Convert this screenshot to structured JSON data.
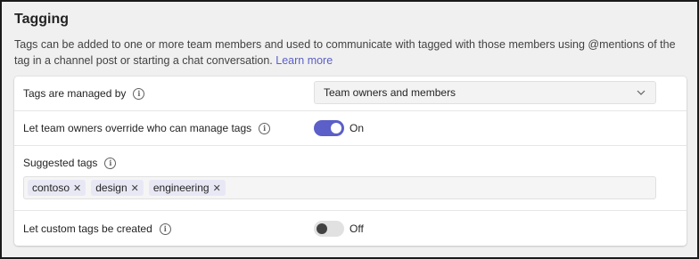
{
  "section": {
    "title": "Tagging",
    "description": "Tags can be added to one or more team members and used to communicate with tagged with those members using @mentions of the tag in a channel post or starting a chat conversation.",
    "learn_more": "Learn more"
  },
  "settings": {
    "managed_by": {
      "label": "Tags are managed by",
      "selected": "Team owners and members"
    },
    "override": {
      "label": "Let team owners override who can manage tags",
      "state": "On",
      "enabled": true
    },
    "suggested": {
      "label": "Suggested tags",
      "tags": [
        "contoso",
        "design",
        "engineering"
      ]
    },
    "custom": {
      "label": "Let custom tags be created",
      "state": "Off",
      "enabled": false
    }
  },
  "icons": {
    "info": "info-icon",
    "chevron": "chevron-down-icon",
    "remove": "close-icon"
  },
  "colors": {
    "accent": "#5b5fc7",
    "tag_bg": "#e8e8f5"
  }
}
